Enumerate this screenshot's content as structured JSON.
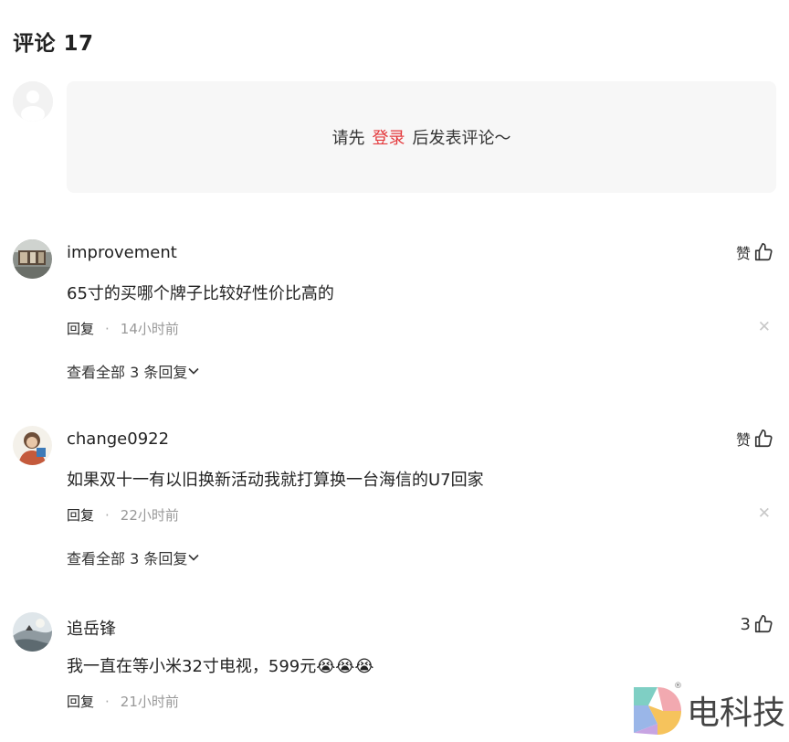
{
  "header": {
    "title": "评论 17"
  },
  "login_prompt": {
    "before": "请先",
    "link": "登录",
    "after": "后发表评论～"
  },
  "comments": [
    {
      "user": "improvement",
      "text": "65寸的买哪个牌子比较好性价比高的",
      "like_label": "赞",
      "reply_label": "回复",
      "time": "14小时前",
      "expand_label": "查看全部 3 条回复"
    },
    {
      "user": "change0922",
      "text": "如果双十一有以旧换新活动我就打算换一台海信的U7回家",
      "like_label": "赞",
      "reply_label": "回复",
      "time": "22小时前",
      "expand_label": "查看全部 3 条回复"
    },
    {
      "user": "追岳锋",
      "text": "我一直在等小米32寸电视，599元",
      "emoji": "😭😭😭",
      "like_label": "3",
      "reply_label": "回复",
      "time": "21小时前"
    }
  ],
  "watermark": {
    "text": "电科技",
    "reg": "®"
  },
  "icons": {
    "like": "thumbs-up-icon",
    "close": "close-icon",
    "expand": "chevron-down-icon",
    "avatar": "avatar"
  },
  "colors": {
    "accent": "#e4393c",
    "muted": "#999999",
    "panel": "#f7f7f7"
  }
}
